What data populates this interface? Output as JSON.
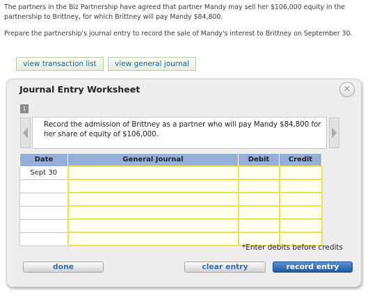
{
  "prompt": {
    "paragraph1": "The partners in the Biz Partnership have agreed that partner Mandy may sell her $106,000 equity in the partnership to Brittney, for which Brittney will pay Mandy $84,800.",
    "paragraph2": "Prepare the partnership's journal entry to record the sale of Mandy's interest to Brittney on September 30."
  },
  "toolbar": {
    "transaction_list_label": "view transaction list",
    "general_journal_label": "view general journal"
  },
  "worksheet": {
    "title": "Journal Entry Worksheet",
    "close_glyph": "✕",
    "step_number": "1",
    "description": "Record the admission of Brittney as a partner who will pay Mandy $84,800 for her share of equity of $106,000.",
    "columns": [
      "Date",
      "General Journal",
      "Debit",
      "Credit"
    ],
    "rows": [
      {
        "date": "Sept 30",
        "account": "",
        "debit": "",
        "credit": ""
      },
      {
        "date": "",
        "account": "",
        "debit": "",
        "credit": ""
      },
      {
        "date": "",
        "account": "",
        "debit": "",
        "credit": ""
      },
      {
        "date": "",
        "account": "",
        "debit": "",
        "credit": ""
      },
      {
        "date": "",
        "account": "",
        "debit": "",
        "credit": ""
      },
      {
        "date": "",
        "account": "",
        "debit": "",
        "credit": ""
      }
    ],
    "note": "*Enter debits before credits",
    "buttons": {
      "done": "done",
      "clear": "clear entry",
      "record": "record entry"
    }
  },
  "colors": {
    "table_header": "#95aedb",
    "input_border": "#e9e34d",
    "link_blue": "#1d64a8",
    "primary_button": "#1e5aa6"
  }
}
